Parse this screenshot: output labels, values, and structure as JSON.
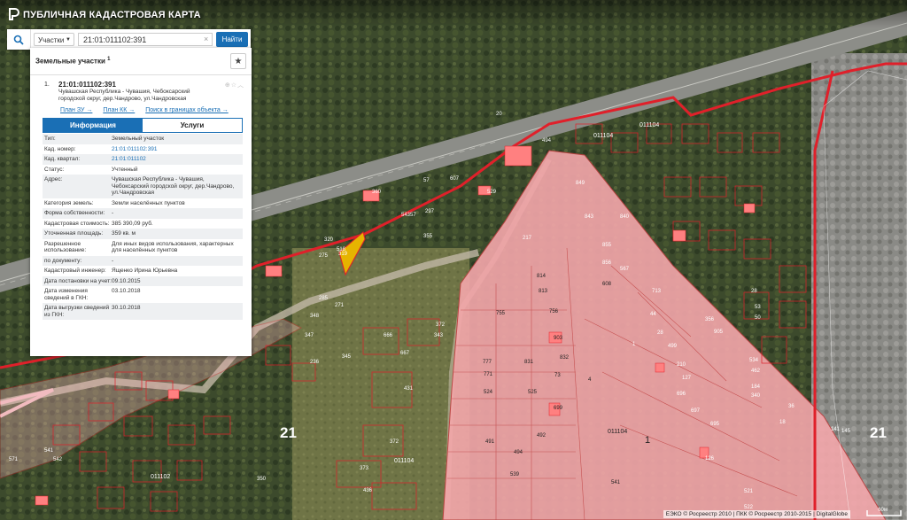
{
  "app": {
    "title": "ПУБЛИЧНАЯ КАДАСТРОВАЯ КАРТА"
  },
  "search": {
    "type_label": "Участки",
    "query": "21:01:011102:391",
    "find_label": "Найти"
  },
  "panel": {
    "header": "Земельные участки",
    "header_count": "1",
    "result": {
      "index": "1.",
      "title": "21:01:011102:391",
      "address": "Чувашская Республика - Чувашия, Чебоксарский городской округ, дер.Чандрово, ул.Чандровская"
    },
    "links": [
      "План ЗУ →",
      "План КК →",
      "Поиск в границах объекта →"
    ],
    "tabs": {
      "info": "Информация",
      "services": "Услуги"
    },
    "rows": [
      {
        "k": "Тип:",
        "v": "Земельный участок"
      },
      {
        "k": "Кад. номер:",
        "v": "21:01:011102:391"
      },
      {
        "k": "Кад. квартал:",
        "v": "21:01:011102"
      },
      {
        "k": "Статус:",
        "v": "Учтенный"
      },
      {
        "k": "Адрес:",
        "v": "Чувашская Республика - Чувашия, Чебоксарский городской округ, дер.Чандрово, ул.Чандровская"
      },
      {
        "k": "Категория земель:",
        "v": "Земли населённых пунктов"
      },
      {
        "k": "Форма собственности:",
        "v": "-"
      },
      {
        "k": "Кадастровая стоимость:",
        "v": "385 390,09 руб."
      },
      {
        "k": "Уточненная площадь:",
        "v": "359 кв. м"
      },
      {
        "k": "Разрешенное использование:",
        "v": "Для иных видов использования, характерных для населённых пунктов"
      },
      {
        "k": "по документу:",
        "v": "-"
      },
      {
        "k": "Кадастровый инженер:",
        "v": "Ященко Ирина Юрьевна"
      },
      {
        "k": "Дата постановки на учет:",
        "v": "09.10.2015"
      },
      {
        "k": "Дата изменения сведений в ГКН:",
        "v": "03.10.2018"
      },
      {
        "k": "Дата выгрузки сведений из ГКН:",
        "v": "30.10.2018"
      }
    ]
  },
  "map": {
    "district_labels": [
      "21",
      "21"
    ],
    "district_label_center": "1",
    "quarter_labels": [
      "011104",
      "011104",
      "011104",
      "011104",
      "011102"
    ],
    "plot_numbers": [
      "494",
      "849",
      "843",
      "840",
      "855",
      "856",
      "567",
      "608",
      "814",
      "813",
      "755",
      "756",
      "903",
      "831",
      "832",
      "777",
      "771",
      "524",
      "525",
      "491",
      "492",
      "494",
      "539",
      "541",
      "521",
      "522",
      "1",
      "73",
      "4",
      "699",
      "210",
      "499",
      "28",
      "44",
      "713",
      "356",
      "905",
      "126",
      "695",
      "697",
      "127",
      "696",
      "534",
      "462",
      "184",
      "340",
      "36",
      "145",
      "141",
      "53",
      "50",
      "18",
      "28",
      "20",
      "57",
      "297",
      "355",
      "372",
      "373",
      "436",
      "431",
      "667",
      "666",
      "372",
      "343",
      "350",
      "347",
      "348",
      "236",
      "345",
      "285",
      "271",
      "275",
      "541",
      "542",
      "571",
      "518",
      "529",
      "607",
      "320",
      "319",
      "54357",
      "360",
      "217"
    ],
    "copyright": "ЕЭКО © Росреестр 2010 | ПКК © Росреестр 2010-2015 | DigitalGlobe",
    "scale_label": "60м"
  },
  "colors": {
    "accent": "#1a6fb5",
    "boundary": "#e0202a",
    "parcel_fill": "#f4a7ab"
  }
}
